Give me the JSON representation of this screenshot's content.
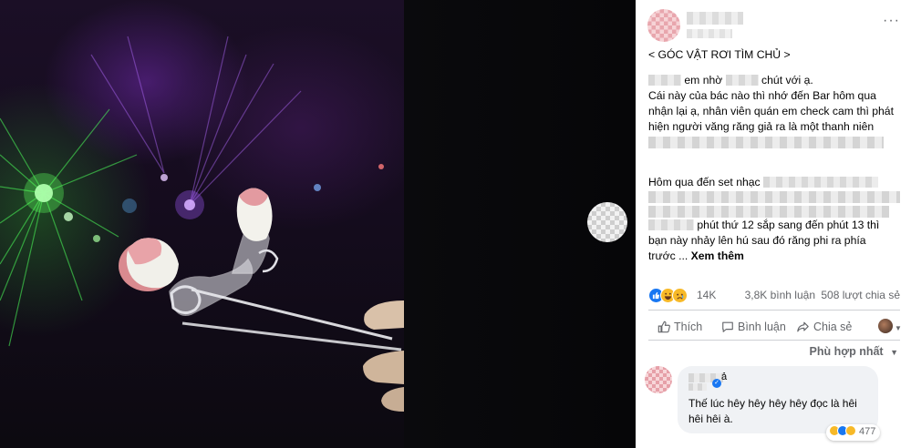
{
  "photo": {
    "subject": "false-teeth-held-by-tweezers"
  },
  "post": {
    "more_icon": "···",
    "lines": {
      "title": "< GÓC VẬT RƠI TÌM CHỦ >",
      "l1_a": "em nhờ",
      "l1_b": "chút với ạ.",
      "l2": "Cái này của bác nào thì nhớ đến Bar hôm qua",
      "l3": "nhận lại ạ, nhân viên quán em check cam thì phát",
      "l4": "hiện người văng răng giả ra là một thanh niên",
      "l5": "Hôm qua đến set nhạc",
      "l6_b": "phút thứ 12 sắp sang đến phút 13 thì",
      "l7": "bạn này nhảy lên hú sau đó răng phi ra phía",
      "l8_a": "trước ...",
      "see_more": "Xem thêm"
    },
    "reactions": {
      "count": "14K",
      "comments": "3,8K bình luận",
      "shares": "508 lượt chia sẻ",
      "icons": [
        "like-icon",
        "haha-icon",
        "sad-icon"
      ]
    },
    "actions": {
      "like": "Thích",
      "comment": "Bình luận",
      "share": "Chia sẻ"
    },
    "sort_label": "Phù hợp nhất"
  },
  "comment": {
    "name_tail": "ả",
    "text": "Thế lúc hêy hêy hêy hêy đọc là hêi hêi hêi à.",
    "reaction_count": "477"
  },
  "colors": {
    "accent": "#1877f2",
    "text_secondary": "#65676b",
    "bubble": "#f0f2f5"
  }
}
